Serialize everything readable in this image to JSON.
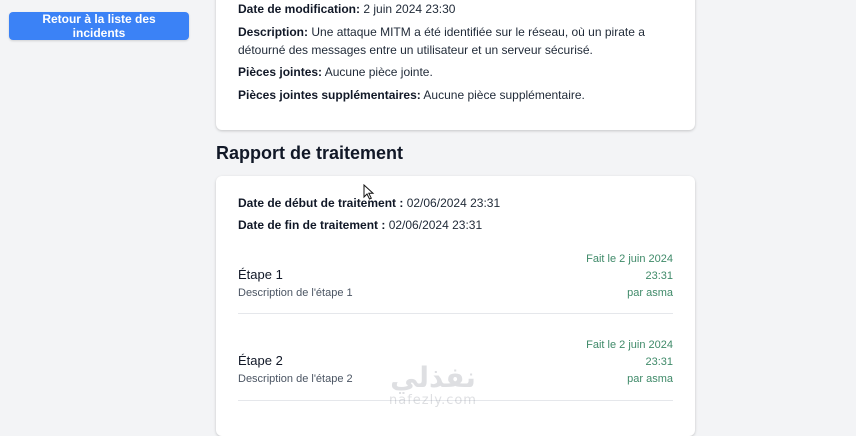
{
  "nav": {
    "back_label": "Retour à la liste des incidents"
  },
  "incident": {
    "modified_label": "Date de modification:",
    "modified_value": "2 juin 2024 23:30",
    "description_label": "Description:",
    "description_value": "Une attaque MITM a été identifiée sur le réseau, où un pirate a détourné des messages entre un utilisateur et un serveur sécurisé.",
    "attachments_label": "Pièces jointes:",
    "attachments_value": "Aucune pièce jointe.",
    "extra_attachments_label": "Pièces jointes supplémentaires:",
    "extra_attachments_value": "Aucune pièce supplémentaire."
  },
  "report": {
    "title": "Rapport de traitement",
    "start_label": "Date de début de traitement :",
    "start_value": "02/06/2024 23:31",
    "end_label": "Date de fin de traitement :",
    "end_value": "02/06/2024 23:31",
    "steps": [
      {
        "title": "Étape 1",
        "description": "Description de l'étape 1",
        "done_line1": "Fait le 2 juin 2024",
        "done_line2": "23:31",
        "by": "par asma"
      },
      {
        "title": "Étape 2",
        "description": "Description de l'étape 2",
        "done_line1": "Fait le 2 juin 2024",
        "done_line2": "23:31",
        "by": "par asma"
      }
    ]
  },
  "watermark": {
    "arabic": "نفذلي",
    "latin": "nafezly.com"
  },
  "colors": {
    "accent": "#3b82f6",
    "step_meta": "#3f8a69",
    "background": "#f3f4f6"
  }
}
